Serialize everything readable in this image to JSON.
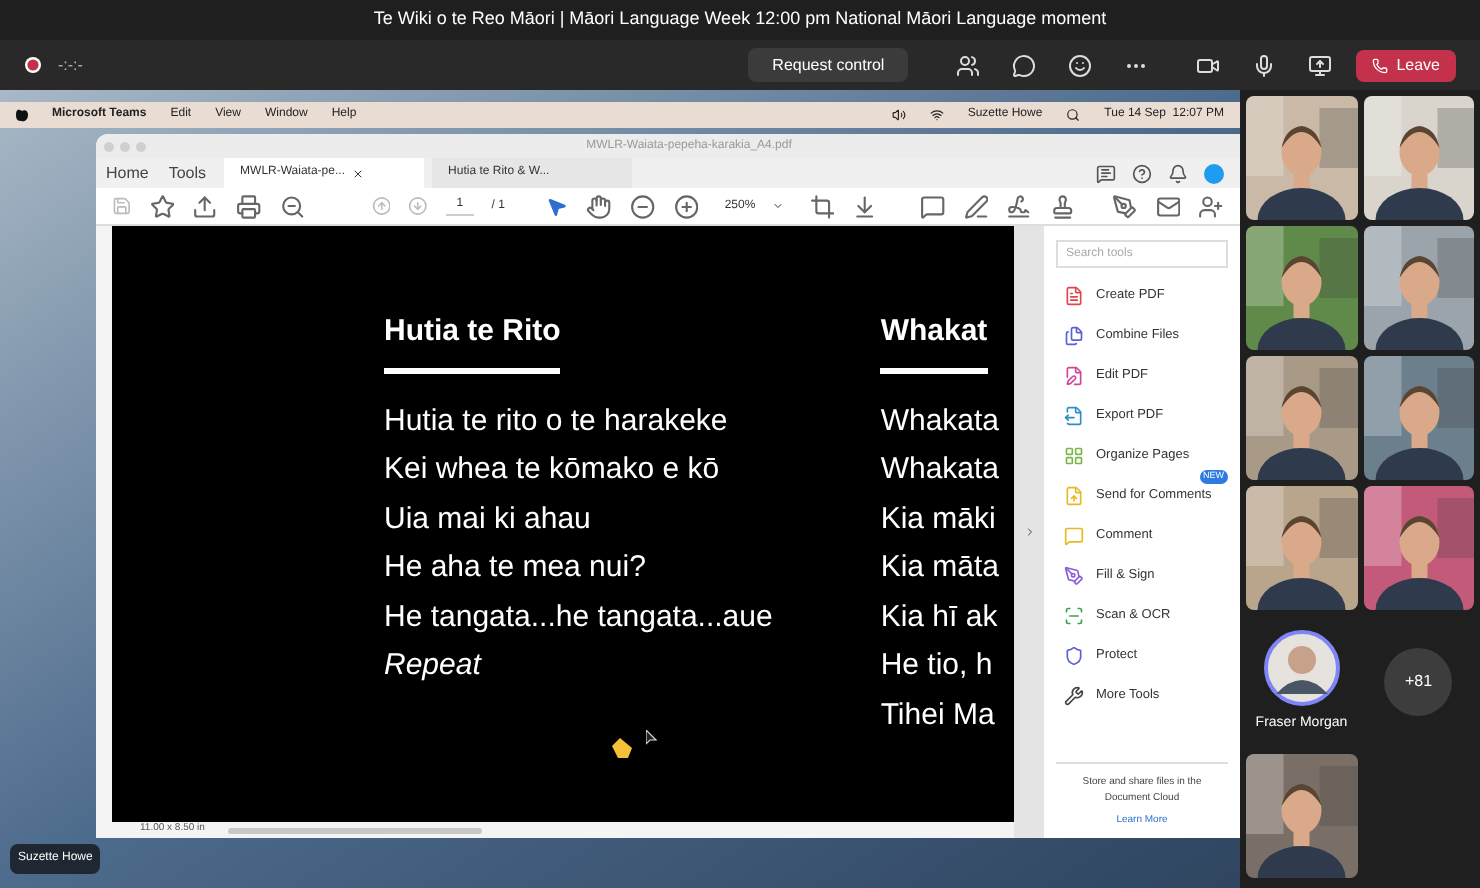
{
  "window": {
    "title": "Te Wiki o te Reo Māori | Māori Language Week 12:00 pm National Māori Language moment"
  },
  "call_bar": {
    "timer": "-:-:-",
    "request_control": "Request control",
    "leave": "Leave"
  },
  "mac_menu": {
    "app": "Microsoft Teams",
    "items": [
      "Edit",
      "View",
      "Window",
      "Help"
    ],
    "user": "Suzette Howe",
    "clock": "Tue 14 Sep  12:07 PM"
  },
  "acrobat": {
    "file_title": "MWLR-Waiata-pepeha-karakia_A4.pdf",
    "nav": [
      "Home",
      "Tools"
    ],
    "tabs": [
      {
        "label": "MWLR-Waiata-pe...",
        "selected": true,
        "closable": true
      },
      {
        "label": "Hutia te Rito & W...",
        "selected": false,
        "closable": false
      }
    ],
    "page": "1",
    "page_total": "/ 1",
    "zoom": "250%",
    "document": {
      "columns": [
        {
          "title": "Hutia te Rito",
          "lines": [
            {
              "text": "Hutia te rito o te harakeke",
              "italic": false
            },
            {
              "text": "Kei whea te kōmako e kō",
              "italic": false
            },
            {
              "text": "Uia mai ki ahau",
              "italic": false
            },
            {
              "text": "He aha te mea nui?",
              "italic": false
            },
            {
              "text": "He tangata...he tangata...aue",
              "italic": false
            },
            {
              "text": "Repeat",
              "italic": true
            }
          ]
        },
        {
          "title": "Whakat",
          "lines": [
            {
              "text": "Whakata",
              "italic": false
            },
            {
              "text": "Whakata",
              "italic": false
            },
            {
              "text": "Kia māki",
              "italic": false
            },
            {
              "text": "Kia māta",
              "italic": false
            },
            {
              "text": "Kia hī ak",
              "italic": false
            },
            {
              "text": "He tio, h",
              "italic": false
            },
            {
              "text": "Tihei Ma",
              "italic": false
            }
          ]
        }
      ]
    },
    "page_size": "11.00 x 8.50 in",
    "tools_search": {
      "placeholder": "Search tools"
    },
    "tools": [
      {
        "label": "Create PDF",
        "color": "#e0474c"
      },
      {
        "label": "Combine Files",
        "color": "#5b5fd6"
      },
      {
        "label": "Edit PDF",
        "color": "#d2469a"
      },
      {
        "label": "Export PDF",
        "color": "#2a8fc9"
      },
      {
        "label": "Organize Pages",
        "color": "#7ab648"
      },
      {
        "label": "Send for Comments",
        "color": "#e8b923",
        "badge": "NEW"
      },
      {
        "label": "Comment",
        "color": "#e8b923"
      },
      {
        "label": "Fill & Sign",
        "color": "#8a5fd6"
      },
      {
        "label": "Scan & OCR",
        "color": "#3aa653"
      },
      {
        "label": "Protect",
        "color": "#5b5fd6"
      },
      {
        "label": "More Tools",
        "color": "#444444"
      }
    ],
    "cloud_note": "Store and share files in the Document Cloud",
    "learn_more": "Learn More"
  },
  "presenter_label": "Suzette Howe",
  "participants": [
    {
      "kind": "video",
      "color": "#c9b9a6"
    },
    {
      "kind": "video",
      "color": "#d9d4cc"
    },
    {
      "kind": "video",
      "color": "#5f8a4a"
    },
    {
      "kind": "video",
      "color": "#9ba4ab"
    },
    {
      "kind": "video",
      "color": "#a89a86"
    },
    {
      "kind": "video",
      "color": "#6b7f8c"
    },
    {
      "kind": "video",
      "color": "#b9a58c"
    },
    {
      "kind": "video",
      "color": "#c45a7a"
    },
    {
      "kind": "avatar",
      "name": "Fraser Morgan"
    },
    {
      "kind": "overflow",
      "count": "+81"
    },
    {
      "kind": "video",
      "color": "#7a6f66"
    }
  ]
}
